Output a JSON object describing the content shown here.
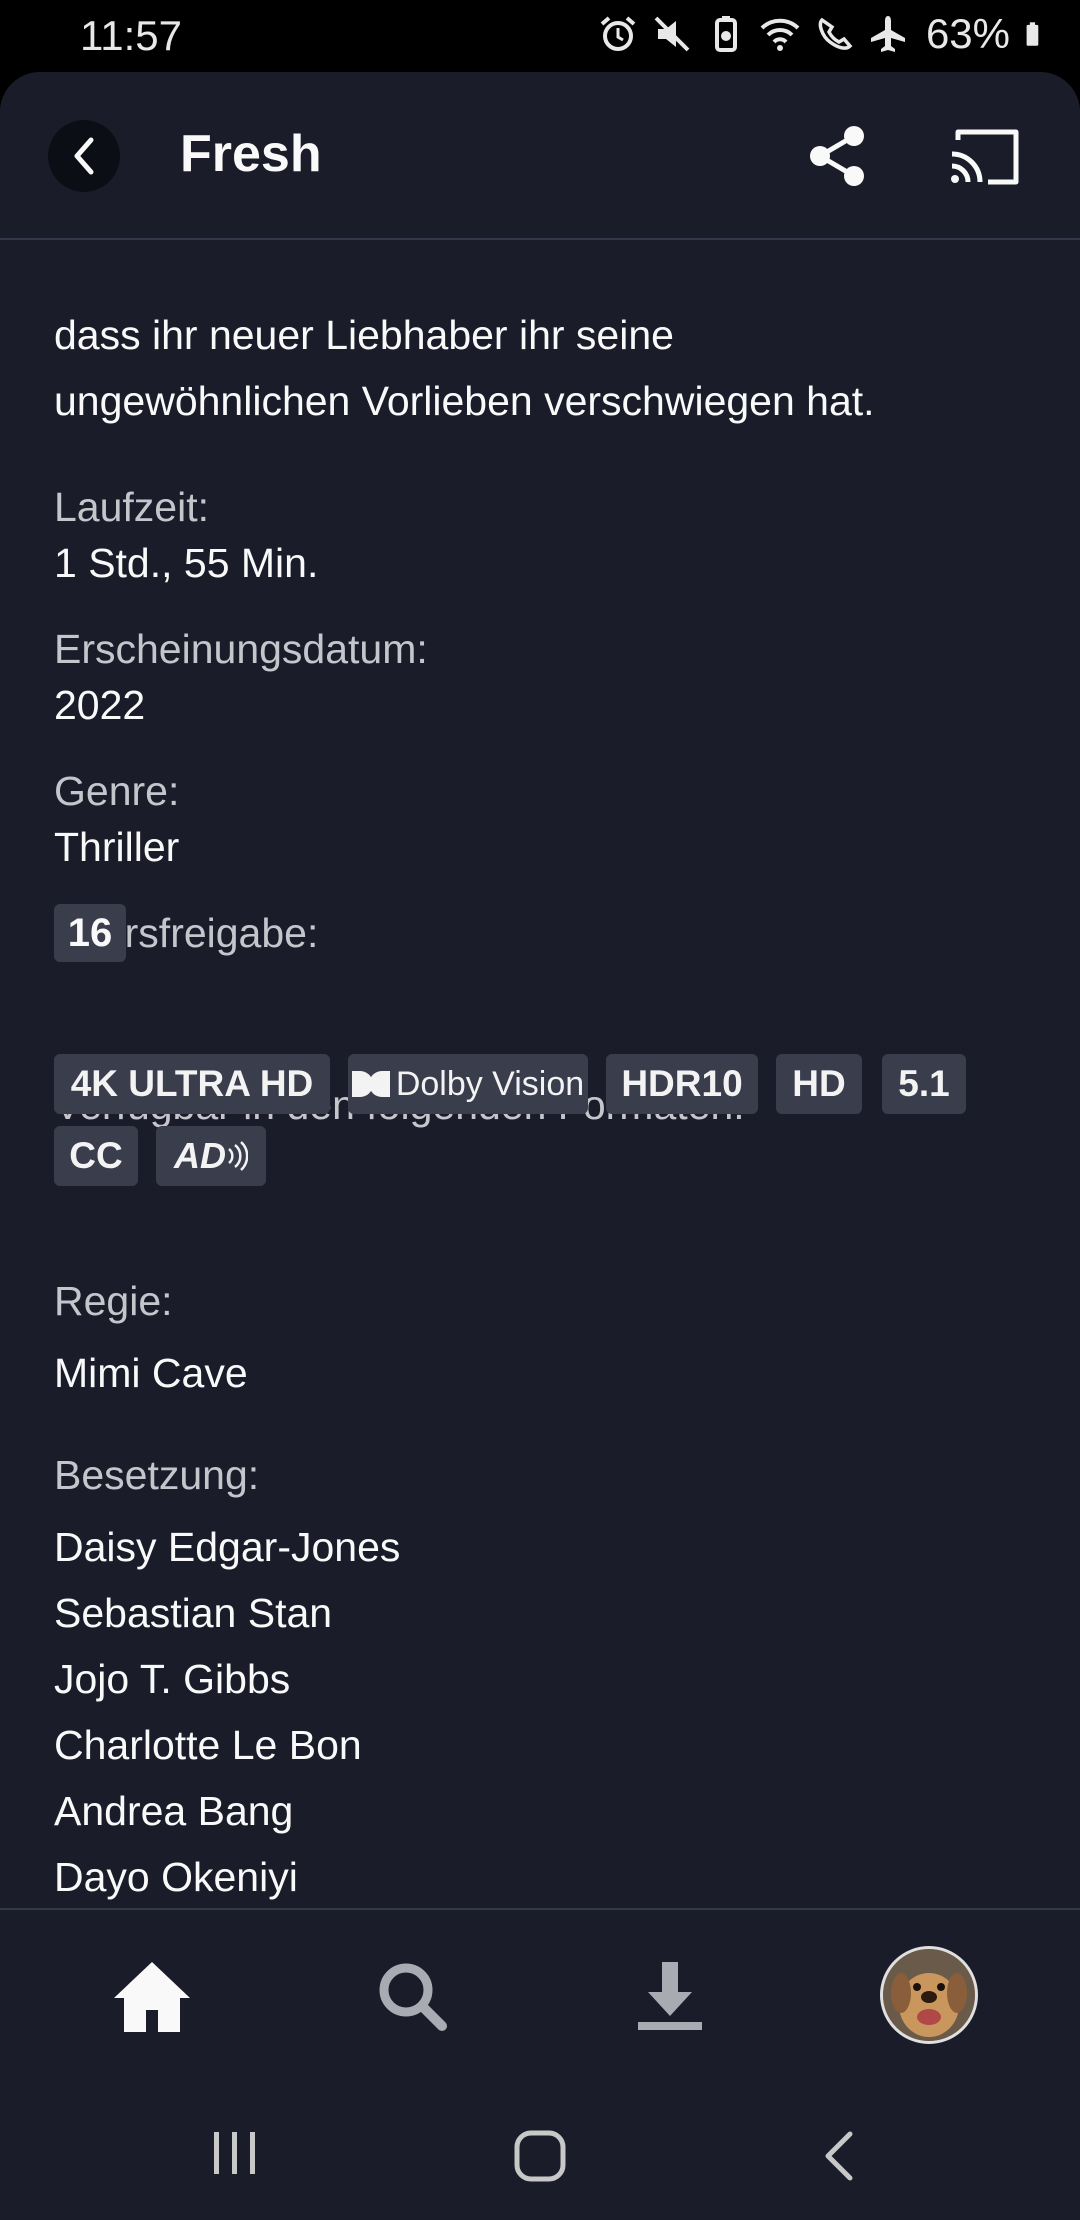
{
  "status_bar": {
    "time": "11:57",
    "battery": "63%"
  },
  "header": {
    "title": "Fresh"
  },
  "description": {
    "line1": "dass ihr neuer Liebhaber ihr seine",
    "line2": "ungewöhnlichen Vorlieben verschwiegen hat."
  },
  "details": {
    "runtime_label": "Laufzeit:",
    "runtime_value": "1 Std., 55 Min.",
    "release_label": "Erscheinungsdatum:",
    "release_value": "2022",
    "genre_label": "Genre:",
    "genre_value": "Thriller",
    "rating_label": "Altersfreigabe:",
    "rating_value": "16",
    "formats_label": "Verfügbar in den folgenden Formaten:",
    "formats": [
      "4K ULTRA HD",
      "Dolby Vision",
      "HDR10",
      "HD",
      "5.1",
      "CC",
      "AD"
    ],
    "director_label": "Regie:",
    "director_value": "Mimi Cave",
    "cast_label": "Besetzung:",
    "cast": [
      "Daisy Edgar-Jones",
      "Sebastian Stan",
      "Jojo T. Gibbs",
      "Charlotte Le Bon",
      "Andrea Bang",
      "Dayo Okeniyi"
    ]
  },
  "colors": {
    "background": "#1a1d29",
    "badge": "#3a3d4c",
    "label": "#c4c6cc",
    "text": "#f9f9f9"
  },
  "icons": {
    "back": "chevron-left-icon",
    "share": "share-icon",
    "cast": "cast-icon",
    "home": "home-icon",
    "search": "search-icon",
    "download": "download-icon",
    "profile": "avatar"
  }
}
